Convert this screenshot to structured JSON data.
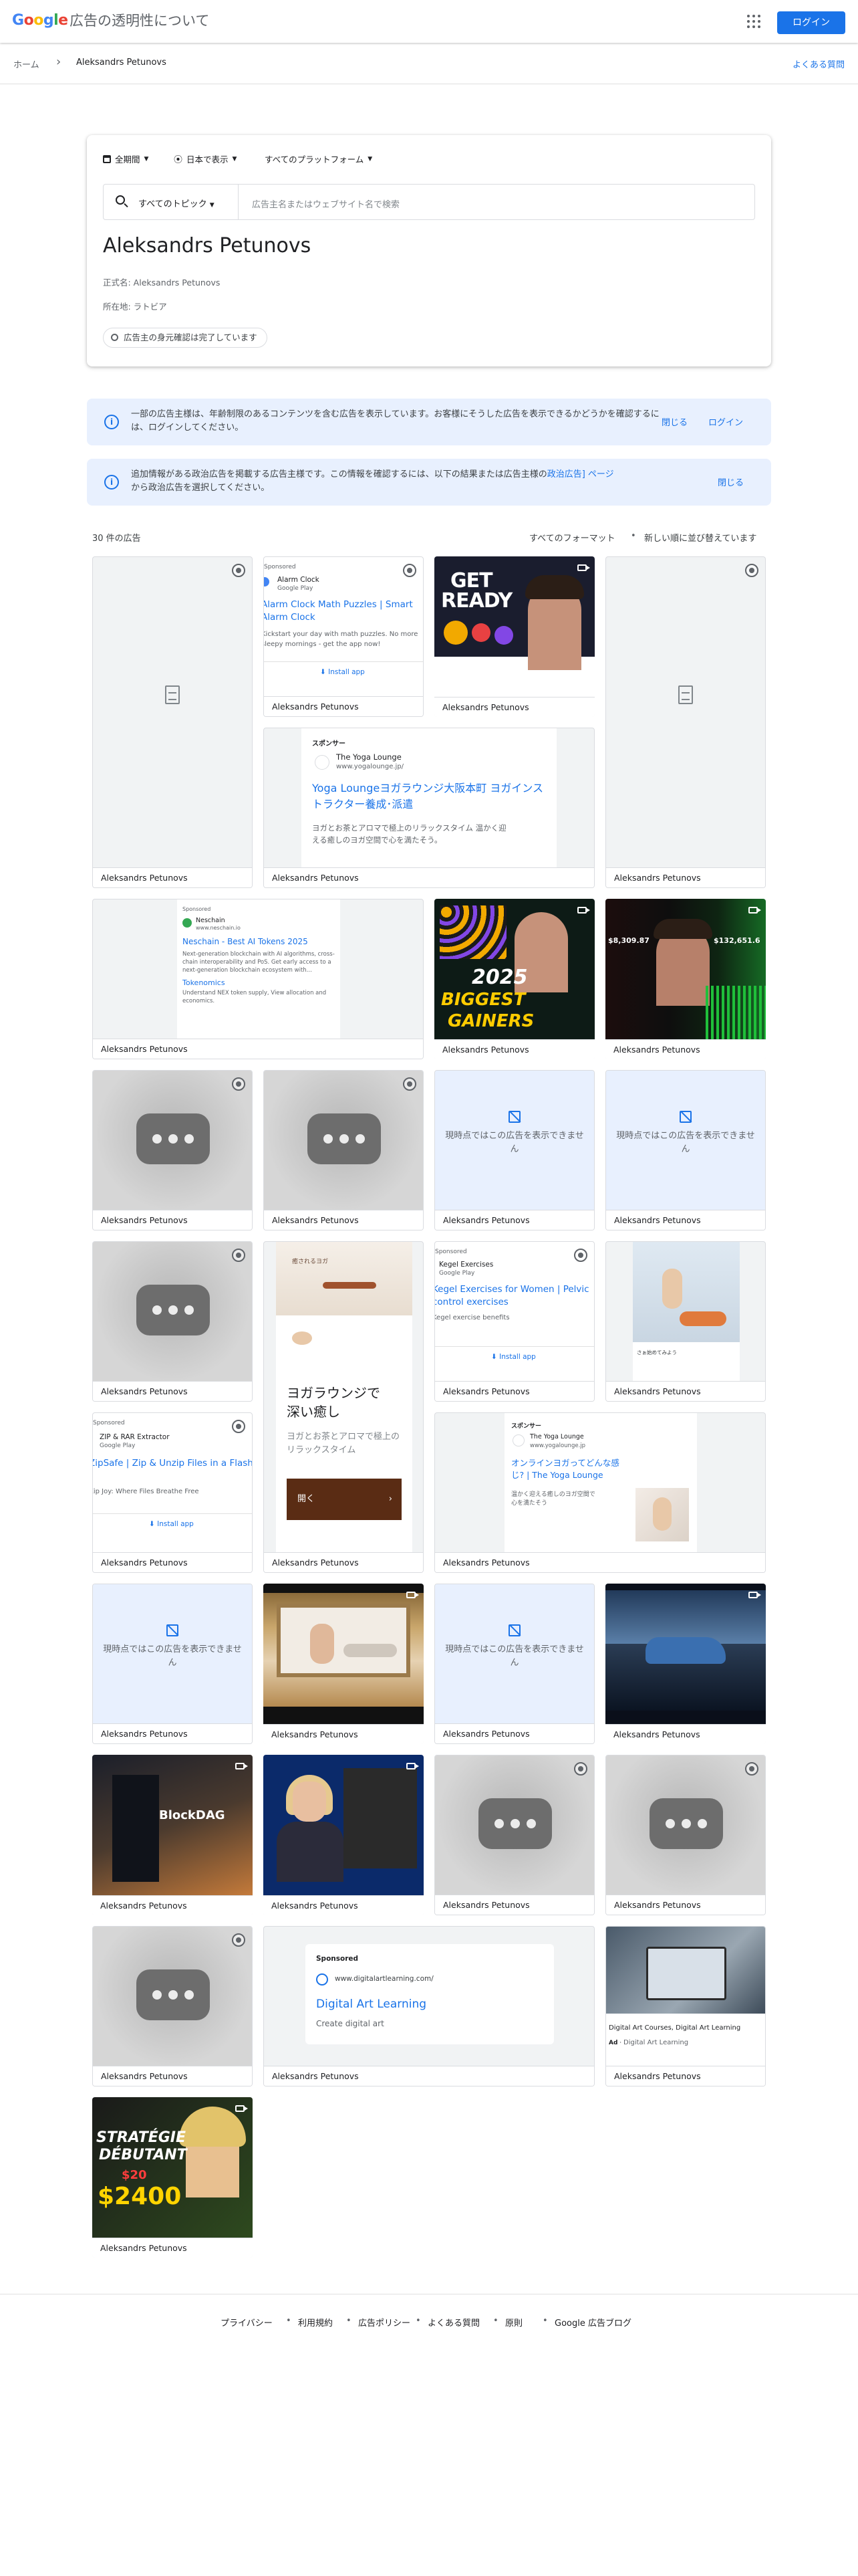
{
  "header": {
    "logo_letters": [
      "G",
      "o",
      "o",
      "g",
      "l",
      "e"
    ],
    "logo_colors": [
      "#4285f4",
      "#ea4335",
      "#fbbc05",
      "#4285f4",
      "#34a853",
      "#ea4335"
    ],
    "app_title": "広告の透明性について",
    "login": "ログイン",
    "apps_icon": "apps-grid-icon"
  },
  "breadcrumb": {
    "home": "ホーム",
    "current": "Aleksandrs Petunovs",
    "faq": "よくある質問"
  },
  "filters": {
    "period": "全期間",
    "region": "日本で表示",
    "platform": "すべてのプラットフォーム",
    "topic": "すべてのトピック",
    "search_placeholder": "広告主名またはウェブサイト名で検索"
  },
  "advertiser": {
    "name": "Aleksandrs Petunovs",
    "legal_name": "正式名: Aleksandrs Petunovs",
    "location": "所在地: ラトビア",
    "verified": "広告主の身元確認は完了しています"
  },
  "banners": [
    {
      "text": "一部の広告主様は、年齢制限のあるコンテンツを含む広告を表示しています。お客様にそうした広告を表示できるかどうかを確認するには、ログインしてください。",
      "close": "閉じる",
      "login": "ログイン"
    },
    {
      "text_a": "追加情報がある政治広告を掲載する広告主様です。この情報を確認するには、以下の結果または広告主様の",
      "text_link": "政治広告] ページ",
      "text_b": "から政治広告を選択してください。",
      "close": "閉じる"
    }
  ],
  "results": {
    "count": "30 件の広告",
    "format": "すべてのフォーマット",
    "sort": "新しい順に並び替えています",
    "bullet": "•"
  },
  "ads": {
    "caption": "Aleksandrs Petunovs",
    "unavailable": "現時点ではこの広告を表示できません",
    "alarm": {
      "sponsored": "Sponsored",
      "app": "Alarm Clock",
      "store": "Google Play",
      "headline": "Alarm Clock Math Puzzles | Smart Alarm Clock",
      "body": "Kickstart your day with math puzzles. No more sleepy mornings - get the app now!",
      "cta": "Install app"
    },
    "yoga1": {
      "sponsored": "スポンサー",
      "name": "The Yoga Lounge",
      "url": "www.yogalounge.jp/",
      "headline": "Yoga Loungeヨガラウンジ大阪本町 ヨガインストラクター養成･派遣",
      "body": "ヨガとお茶とアロマで極上のリラックスタイム 温かく迎える癒しのヨガ空間で心を満たそう。"
    },
    "getready": {
      "line1": "GET",
      "line2": "READY"
    },
    "neschain": {
      "sponsored": "Sponsored",
      "name": "Neschain",
      "url": "www.neschain.io",
      "headline": "Neschain - Best AI Tokens 2025",
      "body": "Next-generation blockchain with AI algorithms, cross-chain interoperability and PoS. Get early access to a next-generation blockchain ecosystem with...",
      "link2": "Tokenomics",
      "body2": "Understand NEX token supply, View allocation and economics."
    },
    "gainers": {
      "year": "2025",
      "line1": "BIGGEST",
      "line2": "GAINERS"
    },
    "green": {
      "left": "$8,309.87",
      "right": "$132,651.6"
    },
    "yoga2": {
      "headline1": "ヨガラウンジで",
      "headline2": "深い癒し",
      "body": "ヨガとお茶とアロマで極上のリラックスタイム",
      "cta": "開く",
      "top": "癒されるヨガ"
    },
    "kegel": {
      "sponsored": "Sponsored",
      "app": "Kegel Exercises",
      "store": "Google Play",
      "headline": "Kegel Exercises for Women | Pelvic control exercises",
      "body": "Kegel exercise benefits",
      "cta": "Install app"
    },
    "zip": {
      "sponsored": "Sponsored",
      "app": "ZIP & RAR Extractor",
      "store": "Google Play",
      "headline": "ZipSafe | Zip & Unzip Files in a Flash",
      "body": "Zip Joy: Where Files Breathe Free",
      "cta": "Install app"
    },
    "yoga3": {
      "sponsored": "スポンサー",
      "name": "The Yoga Lounge",
      "url": "www.yogalounge.jp",
      "headline": "オンラインヨガってどんな感じ? | The Yoga Lounge",
      "body": "温かく迎える癒しのヨガ空間で心を満たそう"
    },
    "yoga4": {
      "body": "さぁ始めてみよう"
    },
    "block": {
      "text": "BlockDAG"
    },
    "digital": {
      "sponsored": "Sponsored",
      "url": "www.digitalartlearning.com/",
      "headline": "Digital Art Learning",
      "body": "Create digital art"
    },
    "digital2": {
      "title": "Digital Art Courses, Digital Art Learning",
      "ad": "Ad",
      "src": "Digital Art Learning"
    },
    "strategie": {
      "line1": "STRATÉGIE",
      "line2": "DÉBUTANT",
      "line3": "$20",
      "line4": "$2400"
    }
  },
  "footer": [
    "プライバシー",
    "利用規約",
    "広告ポリシー",
    "よくある質問",
    "原則",
    "Google 広告ブログ"
  ]
}
